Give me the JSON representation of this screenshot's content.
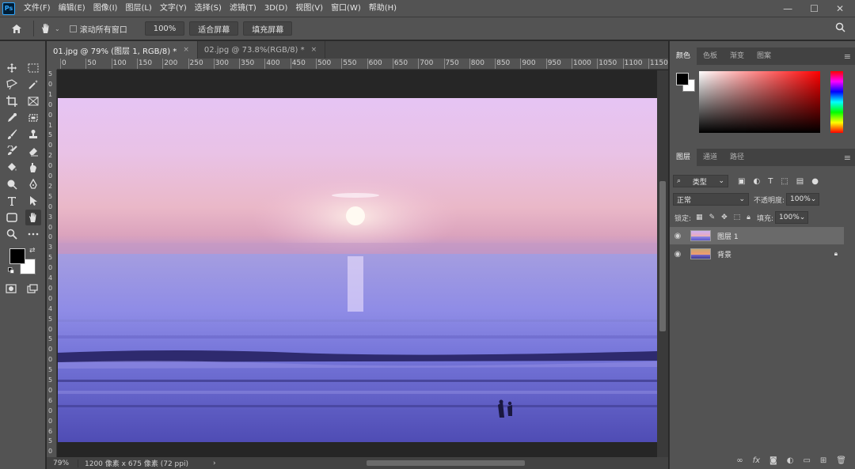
{
  "app": {
    "logo": "Ps"
  },
  "menu": [
    "文件(F)",
    "编辑(E)",
    "图像(I)",
    "图层(L)",
    "文字(Y)",
    "选择(S)",
    "滤镜(T)",
    "3D(D)",
    "视图(V)",
    "窗口(W)",
    "帮助(H)"
  ],
  "window_controls": {
    "minimize": "—",
    "maximize": "☐",
    "close": "✕"
  },
  "options": {
    "scroll_all_label": "滚动所有窗口",
    "zoom_value": "100%",
    "fit_screen": "适合屏幕",
    "fill_screen": "填充屏幕"
  },
  "tabs": [
    {
      "label": "01.jpg @ 79% (图层 1, RGB/8) *",
      "close": "×"
    },
    {
      "label": "02.jpg @ 73.8%(RGB/8) *",
      "close": "×"
    }
  ],
  "ruler_h": [
    "0",
    "50",
    "100",
    "150",
    "200",
    "250",
    "300",
    "350",
    "400",
    "450",
    "500",
    "550",
    "600",
    "650",
    "700",
    "750",
    "800",
    "850",
    "900",
    "950",
    "1000",
    "1050",
    "1100",
    "1150"
  ],
  "ruler_v": [
    "5",
    "0",
    "1",
    "0",
    "0",
    "1",
    "5",
    "0",
    "2",
    "0",
    "0",
    "2",
    "5",
    "0",
    "3",
    "0",
    "0",
    "3",
    "5",
    "0",
    "4",
    "0",
    "0",
    "4",
    "5",
    "0",
    "5",
    "0",
    "0",
    "5",
    "5",
    "0",
    "6",
    "0",
    "0",
    "6",
    "5",
    "0"
  ],
  "status": {
    "zoom": "79%",
    "info": "1200 像素 x 675 像素 (72 ppi)",
    "arrow": "›"
  },
  "color_panel": {
    "tabs": [
      "颜色",
      "色板",
      "渐变",
      "图案"
    ],
    "fg": "#000000",
    "bg": "#ffffff"
  },
  "layers_panel": {
    "tabs": [
      "图层",
      "通道",
      "路径"
    ],
    "filter": "类型",
    "blend_mode": "正常",
    "opacity_label": "不透明度:",
    "opacity_value": "100%",
    "lock_label": "锁定:",
    "fill_label": "填充:",
    "fill_value": "100%",
    "layers": [
      {
        "name": "图层 1",
        "selected": true
      },
      {
        "name": "背景",
        "locked": true
      }
    ],
    "footer_fx": "fx"
  }
}
